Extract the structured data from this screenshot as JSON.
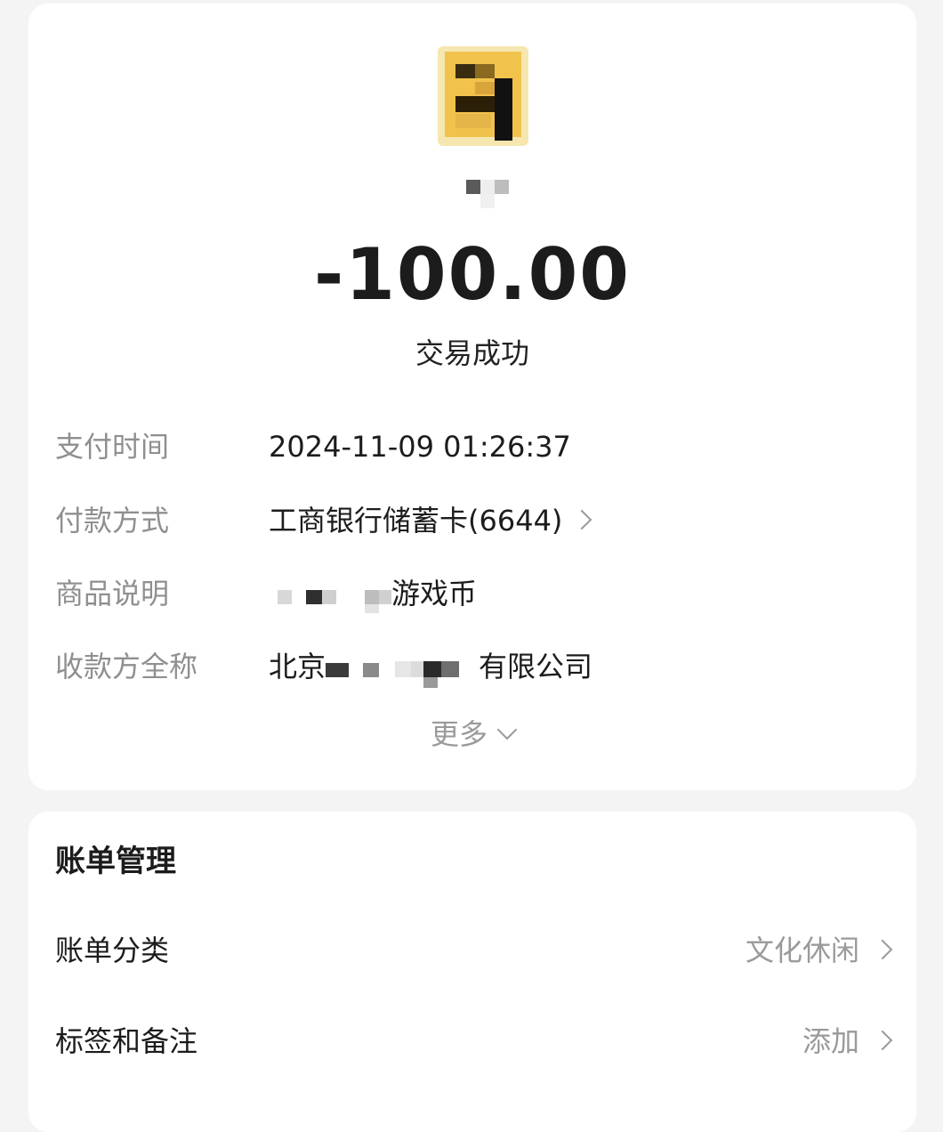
{
  "transaction": {
    "amount": "-100.00",
    "status": "交易成功"
  },
  "details": {
    "pay_time_label": "支付时间",
    "pay_time_value": "2024-11-09 01:26:37",
    "payment_method_label": "付款方式",
    "payment_method_value": "工商银行储蓄卡(6644)",
    "product_label": "商品说明",
    "product_value_visible": "游戏币",
    "payee_label": "收款方全称",
    "payee_prefix": "北京",
    "payee_suffix": "有限公司",
    "more_label": "更多"
  },
  "bill_management": {
    "title": "账单管理",
    "category_label": "账单分类",
    "category_value": "文化休闲",
    "tags_label": "标签和备注",
    "tags_value": "添加"
  },
  "icons": {
    "payment_method_chevron": "chevron-right-icon",
    "more_chevron": "chevron-down-icon",
    "category_chevron": "chevron-right-icon",
    "tags_chevron": "chevron-right-icon"
  },
  "colors": {
    "background": "#f4f4f4",
    "card": "#ffffff",
    "avatar_yellow": "#f1c24c",
    "muted_text": "#8f8f8f"
  }
}
